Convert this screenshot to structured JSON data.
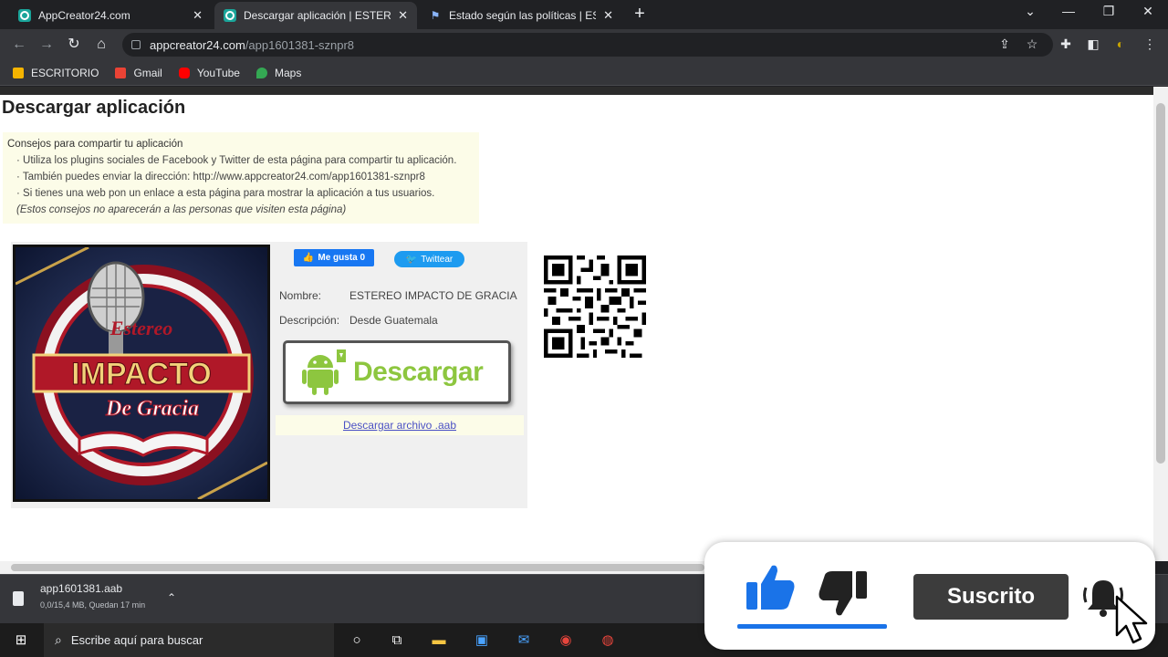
{
  "tabs": [
    {
      "title": "AppCreator24.com"
    },
    {
      "title": "Descargar aplicación | ESTEREO IMPACTO DE GRACIA"
    },
    {
      "title": "Estado según las políticas | ESTEREO IMPACTO"
    }
  ],
  "address": {
    "host": "appcreator24.com",
    "path": "/app1601381-sznpr8"
  },
  "bookmarks": [
    {
      "label": "ESCRITORIO",
      "color": "#f5b400"
    },
    {
      "label": "Gmail",
      "color": "#ea4335"
    },
    {
      "label": "YouTube",
      "color": "#ff0000"
    },
    {
      "label": "Maps",
      "color": "#34a853"
    }
  ],
  "page": {
    "title": "Descargar aplicación",
    "tips": {
      "heading": "Consejos para compartir tu aplicación",
      "items": [
        "· Utiliza los plugins sociales de Facebook y Twitter de esta página para compartir tu aplicación.",
        "· También puedes enviar la dirección: http://www.appcreator24.com/app1601381-sznpr8",
        "· Si tienes una web pon un enlace a esta página para mostrar la aplicación a tus usuarios."
      ],
      "note": "(Estos consejos no aparecerán a las personas que visiten esta página)"
    },
    "like_label": "Me gusta 0",
    "tweet_label": "Twittear",
    "name_label": "Nombre:",
    "name_value": "ESTEREO IMPACTO DE GRACIA",
    "desc_label": "Descripción:",
    "desc_value": "Desde Guatemala",
    "download_label": "Descargar",
    "aab_link": "Descargar archivo .aab",
    "logo_text": {
      "top": "Estereo",
      "main": "IMPACTO",
      "bottom": "De Gracia"
    }
  },
  "download_bar": {
    "file": "app1601381.aab",
    "status": "0,0/15,4 MB, Quedan 17 min"
  },
  "taskbar": {
    "search_placeholder": "Escribe aquí para buscar"
  },
  "overlay": {
    "subscribe_label": "Suscrito"
  },
  "colors": {
    "accent_blue": "#1a73e8",
    "download_green": "#8dc63f",
    "teal": "#1aa59a"
  }
}
